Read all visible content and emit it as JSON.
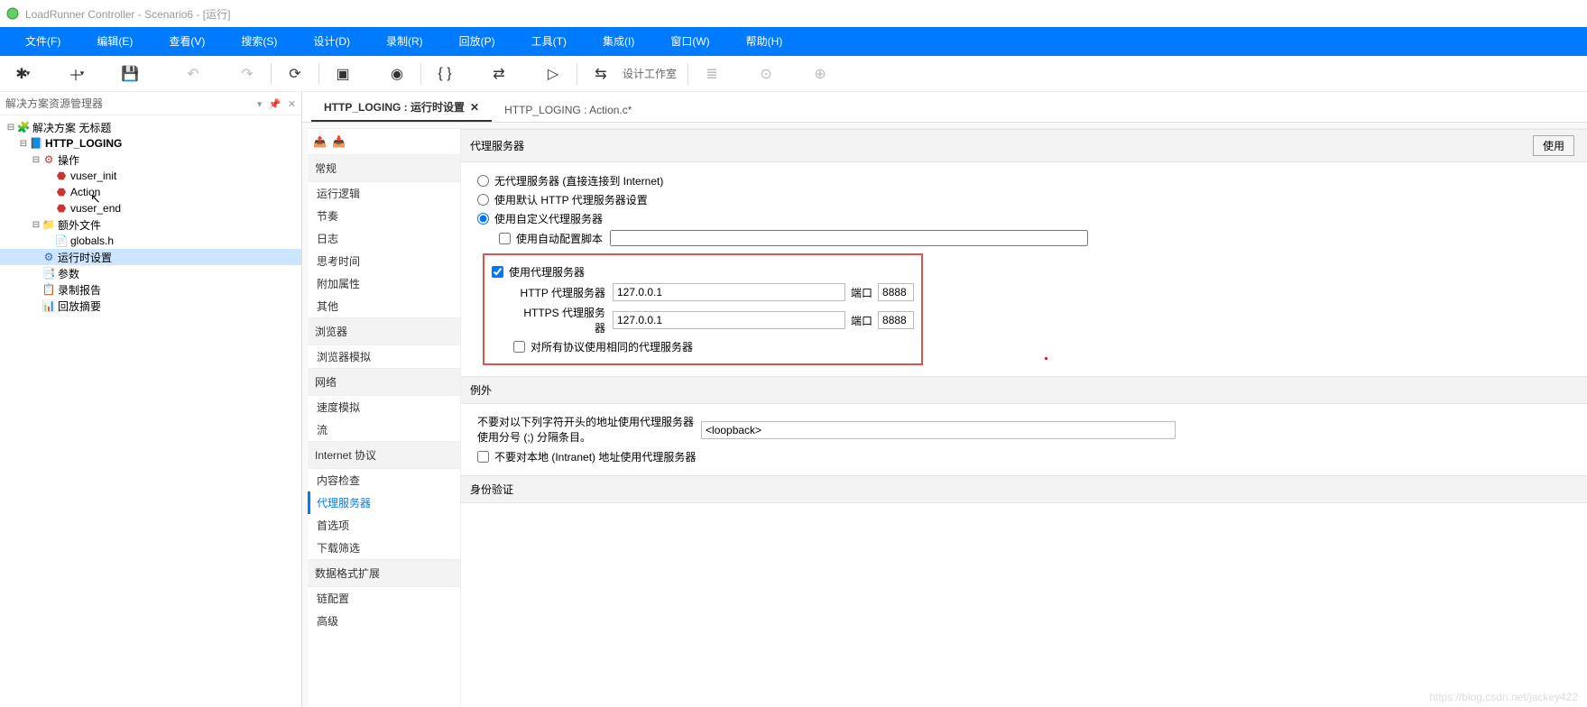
{
  "title": "LoadRunner Controller - Scenario6 - [运行]",
  "menus": [
    "文件(F)",
    "编辑(E)",
    "查看(V)",
    "搜索(S)",
    "设计(D)",
    "录制(R)",
    "回放(P)",
    "工具(T)",
    "集成(I)",
    "窗口(W)",
    "帮助(H)"
  ],
  "toolbar_design_label": "设计工作室",
  "explorer_title": "解决方案资源管理器",
  "tree": {
    "root": "解决方案 无标题",
    "proj": "HTTP_LOGING",
    "ops": "操作",
    "vinit": "vuser_init",
    "action": "Action",
    "vend": "vuser_end",
    "extra": "额外文件",
    "globals": "globals.h",
    "runtime": "运行时设置",
    "params": "参数",
    "recrpt": "录制报告",
    "replay": "回放摘要"
  },
  "tabs": [
    {
      "label": "HTTP_LOGING : 运行时设置",
      "active": true,
      "closable": true
    },
    {
      "label": "HTTP_LOGING : Action.c*",
      "active": false,
      "closable": false
    }
  ],
  "subnav": {
    "g1": "常规",
    "g1items": [
      "运行逻辑",
      "节奏",
      "日志",
      "思考时间",
      "附加属性",
      "其他"
    ],
    "g2": "浏览器",
    "g2items": [
      "浏览器模拟"
    ],
    "g3": "网络",
    "g3items": [
      "速度模拟",
      "流"
    ],
    "g4": "Internet 协议",
    "g4items": [
      "内容检查",
      "代理服务器",
      "首选项",
      "下载筛选"
    ],
    "g5": "数据格式扩展",
    "g5items": [
      "链配置",
      "高级"
    ]
  },
  "proxy": {
    "section": "代理服务器",
    "use_btn": "使用",
    "r1": "无代理服务器 (直接连接到 Internet)",
    "r2": "使用默认 HTTP 代理服务器设置",
    "r3": "使用自定义代理服务器",
    "auto_script": "使用自动配置脚本",
    "use_proxy": "使用代理服务器",
    "http_label": "HTTP 代理服务器",
    "https_label": "HTTPS 代理服务器",
    "http_host": "127.0.0.1",
    "http_port": "8888",
    "https_host": "127.0.0.1",
    "https_port": "8888",
    "port_label": "端口",
    "same_all": "对所有协议使用相同的代理服务器"
  },
  "exceptions": {
    "section": "例外",
    "note_line1": "不要对以下列字符开头的地址使用代理服务器",
    "note_line2": "使用分号 (;) 分隔条目。",
    "value": "<loopback>",
    "no_intranet": "不要对本地 (Intranet) 地址使用代理服务器"
  },
  "auth_section": "身份验证",
  "watermark": "https://blog.csdn.net/jackey422"
}
